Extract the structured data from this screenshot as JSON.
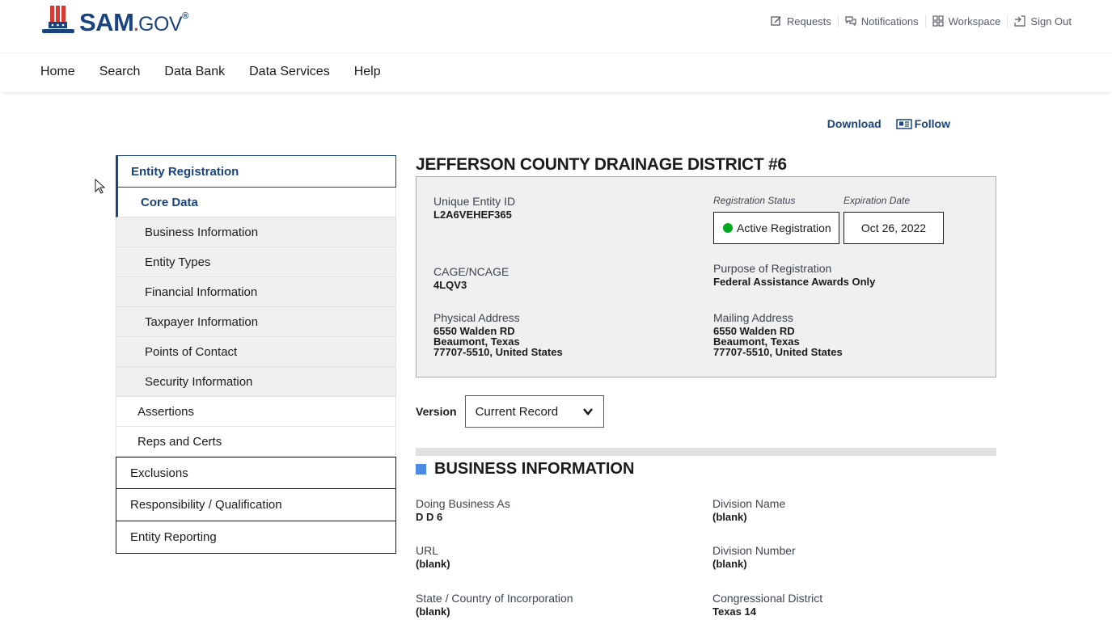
{
  "header": {
    "logo_text_main": "SAM",
    "logo_text_dot": ".",
    "logo_text_gov": "GOV",
    "logo_text_reg": "®",
    "utility": [
      {
        "label": "Requests",
        "icon": "edit-icon"
      },
      {
        "label": "Notifications",
        "icon": "chat-icon"
      },
      {
        "label": "Workspace",
        "icon": "grid-icon"
      },
      {
        "label": "Sign Out",
        "icon": "sign-out-icon"
      }
    ]
  },
  "nav": {
    "items": [
      "Home",
      "Search",
      "Data Bank",
      "Data Services",
      "Help"
    ]
  },
  "actions": {
    "download": "Download",
    "follow": "Follow"
  },
  "sidebar": {
    "entity_registration": "Entity Registration",
    "core_data": "Core Data",
    "sub_items": [
      "Business Information",
      "Entity Types",
      "Financial Information",
      "Taxpayer Information",
      "Points of Contact",
      "Security Information"
    ],
    "assertions": "Assertions",
    "reps_certs": "Reps and Certs",
    "exclusions": "Exclusions",
    "responsibility": "Responsibility / Qualification",
    "entity_reporting": "Entity Reporting"
  },
  "entity": {
    "title": "JEFFERSON COUNTY DRAINAGE DISTRICT #6",
    "uei_label": "Unique Entity ID",
    "uei_value": "L2A6VEHEF365",
    "reg_status_label": "Registration Status",
    "reg_status_value": "Active Registration",
    "exp_label": "Expiration Date",
    "exp_value": "Oct 26, 2022",
    "cage_label": "CAGE/NCAGE",
    "cage_value": "4LQV3",
    "purpose_label": "Purpose of Registration",
    "purpose_value": "Federal Assistance Awards Only",
    "physical_label": "Physical Address",
    "physical_line1": "6550 Walden RD",
    "physical_line2": "Beaumont, Texas",
    "physical_line3": "77707-5510, United States",
    "mailing_label": "Mailing Address",
    "mailing_line1": "6550 Walden RD",
    "mailing_line2": "Beaumont, Texas",
    "mailing_line3": "77707-5510, United States"
  },
  "version": {
    "label": "Version",
    "selected": "Current Record"
  },
  "business_info": {
    "title": "BUSINESS INFORMATION",
    "dba_label": "Doing Business As",
    "dba_value": "D D 6",
    "division_name_label": "Division Name",
    "division_name_value": "(blank)",
    "url_label": "URL",
    "url_value": "(blank)",
    "division_number_label": "Division Number",
    "division_number_value": "(blank)",
    "state_label": "State / Country of Incorporation",
    "state_value": "(blank)",
    "congressional_label": "Congressional District",
    "congressional_value": "Texas 14"
  },
  "colors": {
    "brand_blue": "#1a4480",
    "brand_red": "#d83933",
    "status_green": "#00a91c",
    "section_square": "#4b89e5"
  }
}
